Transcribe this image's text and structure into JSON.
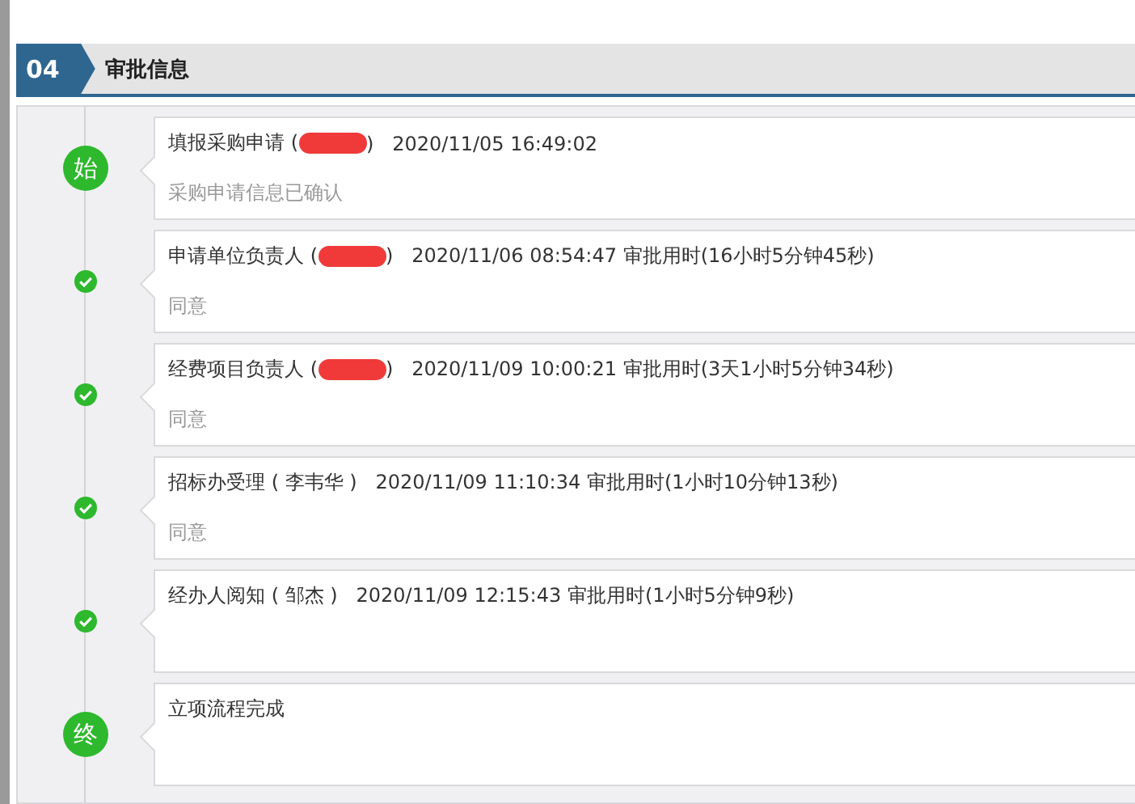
{
  "section": {
    "number": "04",
    "title": "审批信息"
  },
  "steps": [
    {
      "node": {
        "kind": "text",
        "label": "始"
      },
      "title_before": "填报采购申请 (",
      "redacted": true,
      "title_after": ")   2020/11/05 16:49:02",
      "comment": "采购申请信息已确认"
    },
    {
      "node": {
        "kind": "check"
      },
      "title_before": "申请单位负责人 (",
      "redacted": true,
      "title_after": ")   2020/11/06 08:54:47 审批用时(16小时5分钟45秒)",
      "comment": "同意"
    },
    {
      "node": {
        "kind": "check"
      },
      "title_before": "经费项目负责人 (",
      "redacted": true,
      "title_after": ")   2020/11/09 10:00:21 审批用时(3天1小时5分钟34秒)",
      "comment": "同意"
    },
    {
      "node": {
        "kind": "check"
      },
      "title_before": "招标办受理 ( 李韦华 )   2020/11/09 11:10:34 审批用时(1小时10分钟13秒)",
      "redacted": false,
      "comment": "同意"
    },
    {
      "node": {
        "kind": "check"
      },
      "title_before": "经办人阅知 ( 邹杰 )   2020/11/09 12:15:43 审批用时(1小时5分钟9秒)",
      "redacted": false
    },
    {
      "node": {
        "kind": "text",
        "label": "终"
      },
      "title_before": "立项流程完成",
      "redacted": false
    }
  ]
}
